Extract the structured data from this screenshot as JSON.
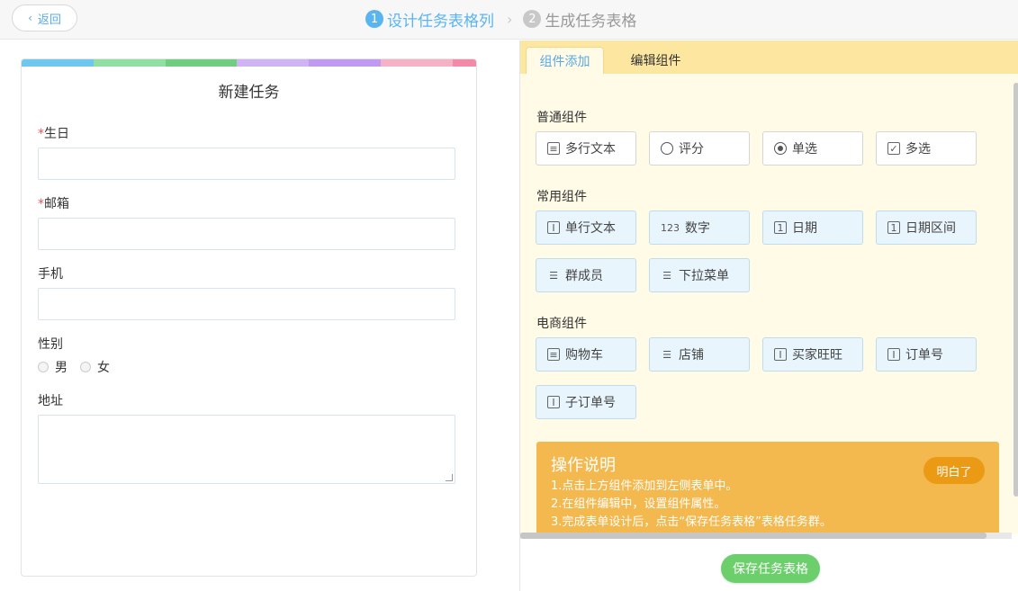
{
  "topbar": {
    "back_label": "返回",
    "steps": [
      {
        "num": "1",
        "label": "设计任务表格列",
        "state": "active"
      },
      {
        "num": "2",
        "label": "生成任务表格",
        "state": "inactive"
      }
    ]
  },
  "form": {
    "stripe_colors": [
      "#6dc7ef",
      "#8fe0a2",
      "#6fce80",
      "#cfb3f4",
      "#c09af0",
      "#f7b1c6",
      "#f48aa9"
    ],
    "title": "新建任务",
    "fields": {
      "birthday": {
        "required_mark": "*",
        "label": "生日"
      },
      "email": {
        "required_mark": "*",
        "label": "邮箱"
      },
      "phone": {
        "label": "手机"
      },
      "gender": {
        "label": "性别",
        "options": [
          "男",
          "女"
        ]
      },
      "address": {
        "label": "地址"
      }
    }
  },
  "panel": {
    "tabs": [
      "组件添加",
      "编辑组件"
    ],
    "sections": {
      "normal": {
        "title": "普通组件",
        "items": [
          {
            "label": "多行文本",
            "icon": "doc-lines-icon"
          },
          {
            "label": "评分",
            "icon": "pie-icon"
          },
          {
            "label": "单选",
            "icon": "radio-icon"
          },
          {
            "label": "多选",
            "icon": "checkbox-icon"
          }
        ]
      },
      "common": {
        "title": "常用组件",
        "items": [
          {
            "label": "单行文本",
            "icon": "text-field-icon"
          },
          {
            "label": "数字",
            "icon": "number-icon",
            "glyph": "123"
          },
          {
            "label": "日期",
            "icon": "calendar-icon"
          },
          {
            "label": "日期区间",
            "icon": "calendar-range-icon"
          },
          {
            "label": "群成员",
            "icon": "list-icon"
          },
          {
            "label": "下拉菜单",
            "icon": "dropdown-list-icon"
          }
        ]
      },
      "ecommerce": {
        "title": "电商组件",
        "items": [
          {
            "label": "购物车",
            "icon": "cart-icon"
          },
          {
            "label": "店铺",
            "icon": "shop-list-icon"
          },
          {
            "label": "买家旺旺",
            "icon": "text-field-icon"
          },
          {
            "label": "订单号",
            "icon": "text-field-icon"
          },
          {
            "label": "子订单号",
            "icon": "text-field-icon"
          }
        ]
      }
    },
    "help": {
      "title": "操作说明",
      "lines": [
        "1.点击上方组件添加到左侧表单中。",
        "2.在组件编辑中，设置组件属性。",
        "3.完成表单设计后，点击“保存任务表格”表格任务群。"
      ],
      "dismiss_label": "明白了"
    },
    "save_label": "保存任务表格"
  }
}
